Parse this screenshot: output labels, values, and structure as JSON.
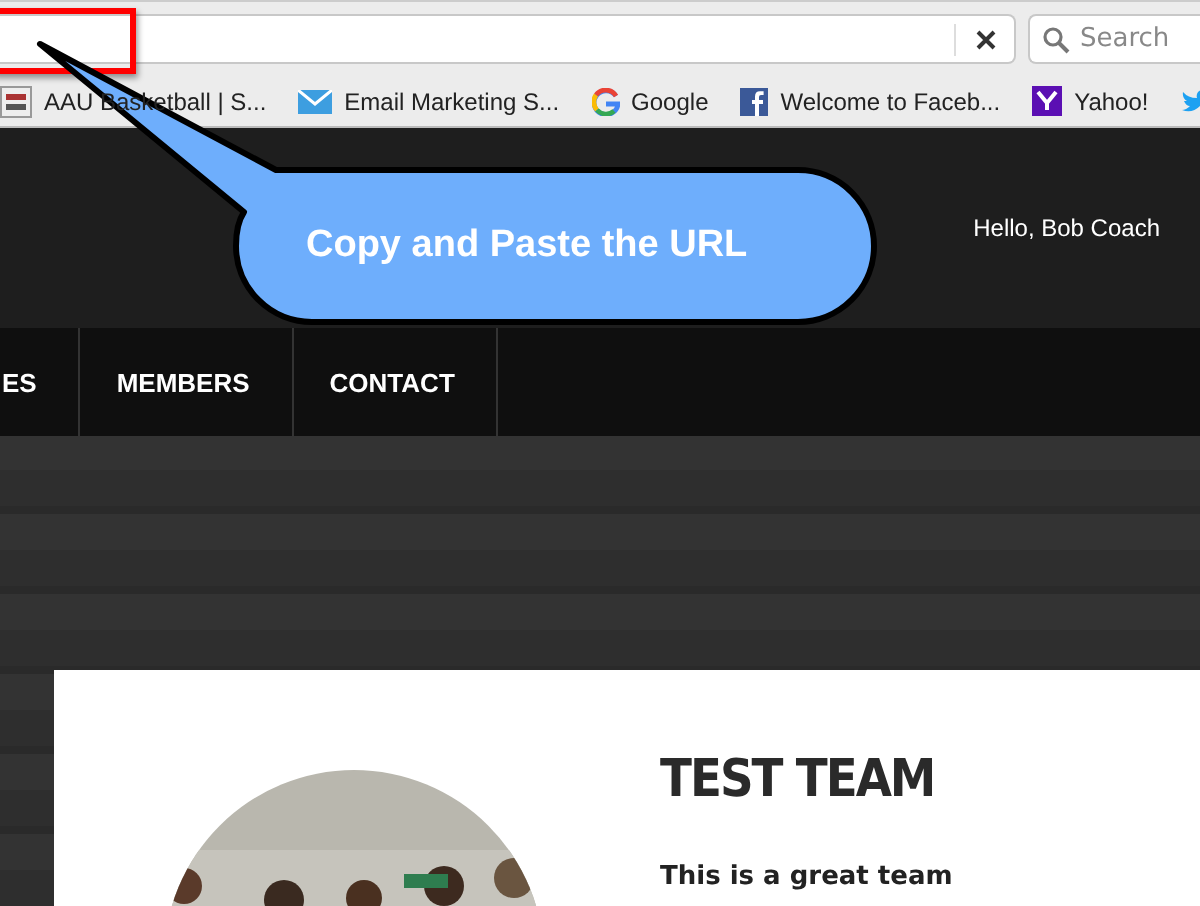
{
  "browser": {
    "search": {
      "placeholder": "Search"
    },
    "bookmarks": [
      {
        "kind": "aau",
        "label": "AAU Basketball | S..."
      },
      {
        "kind": "mail",
        "label": "Email Marketing S..."
      },
      {
        "kind": "google",
        "label": "Google"
      },
      {
        "kind": "facebook",
        "label": "Welcome to Faceb..."
      },
      {
        "kind": "yahoo",
        "label": "Yahoo!"
      },
      {
        "kind": "twitter"
      }
    ]
  },
  "header": {
    "greeting": "Hello, Bob Coach"
  },
  "nav": {
    "items": [
      "ES",
      "MEMBERS",
      "CONTACT"
    ]
  },
  "team": {
    "name": "TEST TEAM",
    "description": "This is a great team"
  },
  "callout": {
    "text": "Copy and Paste the URL"
  }
}
